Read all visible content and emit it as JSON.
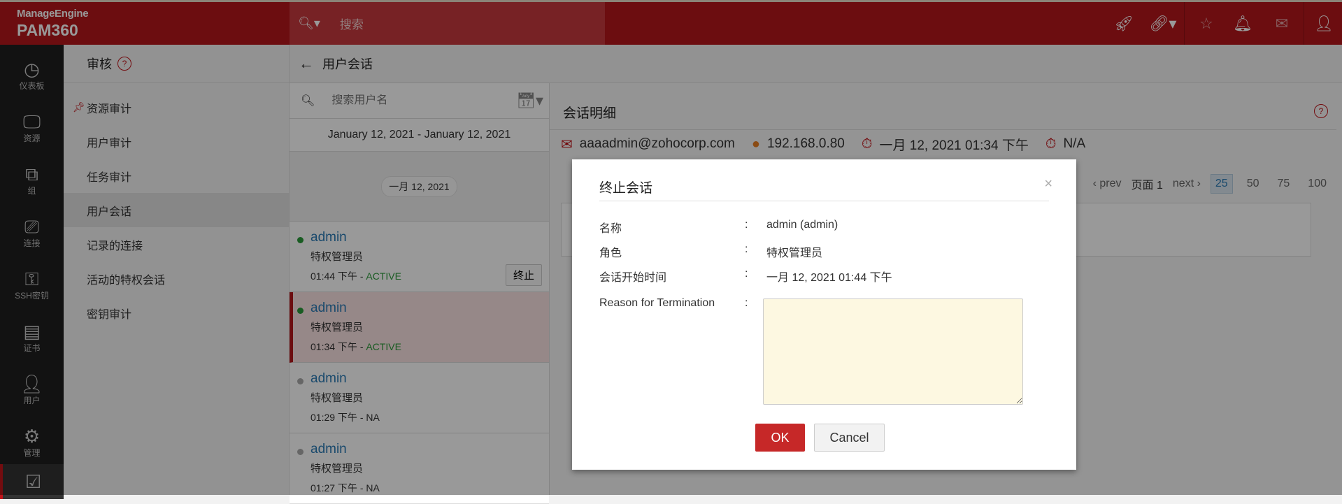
{
  "header": {
    "brand_top": "ManageEngine",
    "brand_main": "PAM360",
    "search_placeholder": "搜索"
  },
  "nav": [
    {
      "label": "仪表板",
      "icon": "dashboard-icon"
    },
    {
      "label": "资源",
      "icon": "monitor-icon"
    },
    {
      "label": "组",
      "icon": "group-icon"
    },
    {
      "label": "连接",
      "icon": "connection-icon"
    },
    {
      "label": "SSH密钥",
      "icon": "ssh-key-icon"
    },
    {
      "label": "证书",
      "icon": "certificate-icon"
    },
    {
      "label": "用户",
      "icon": "user-icon"
    },
    {
      "label": "管理",
      "icon": "gear-icon"
    },
    {
      "label": "",
      "icon": "audit-clipboard-icon"
    }
  ],
  "sidebar": {
    "title": "审核",
    "items": [
      "资源审计",
      "用户审计",
      "任务审计",
      "用户会话",
      "记录的连接",
      "活动的特权会话",
      "密钥审计"
    ]
  },
  "page": {
    "title": "用户会话"
  },
  "sessions": {
    "search_placeholder": "搜索用户名",
    "date_range": "January 12, 2021 - January 12, 2021",
    "date_chip": "一月 12, 2021",
    "items": [
      {
        "name": "admin",
        "role": "特权管理员",
        "time": "01:44 下午 - ",
        "status": "ACTIVE",
        "terminate": "终止"
      },
      {
        "name": "admin",
        "role": "特权管理员",
        "time": "01:34 下午 - ",
        "status": "ACTIVE"
      },
      {
        "name": "admin",
        "role": "特权管理员",
        "time": "01:29 下午 - ",
        "status": "NA"
      },
      {
        "name": "admin",
        "role": "特权管理员",
        "time": "01:27 下午 - ",
        "status": "NA"
      }
    ]
  },
  "detail": {
    "title": "会话明细",
    "email": "aaaadmin@zohocorp.com",
    "ip": "192.168.0.80",
    "start": "一月 12, 2021 01:34 下午",
    "end": "N/A",
    "pager": {
      "prev": "‹ prev",
      "page": "页面 1",
      "next": "next ›",
      "sizes": [
        "25",
        "50",
        "75",
        "100"
      ]
    }
  },
  "modal": {
    "title": "终止会话",
    "close": "×",
    "rows": [
      {
        "label": "名称",
        "value": "admin (admin)"
      },
      {
        "label": "角色",
        "value": "特权管理员"
      },
      {
        "label": "会话开始时间",
        "value": "一月 12, 2021 01:44 下午"
      }
    ],
    "reason_label": "Reason for Termination",
    "colon": ":",
    "ok": "OK",
    "cancel": "Cancel"
  },
  "colors": {
    "brand": "#b5171c",
    "active": "#2a9a3a",
    "link": "#2a7ab5"
  }
}
